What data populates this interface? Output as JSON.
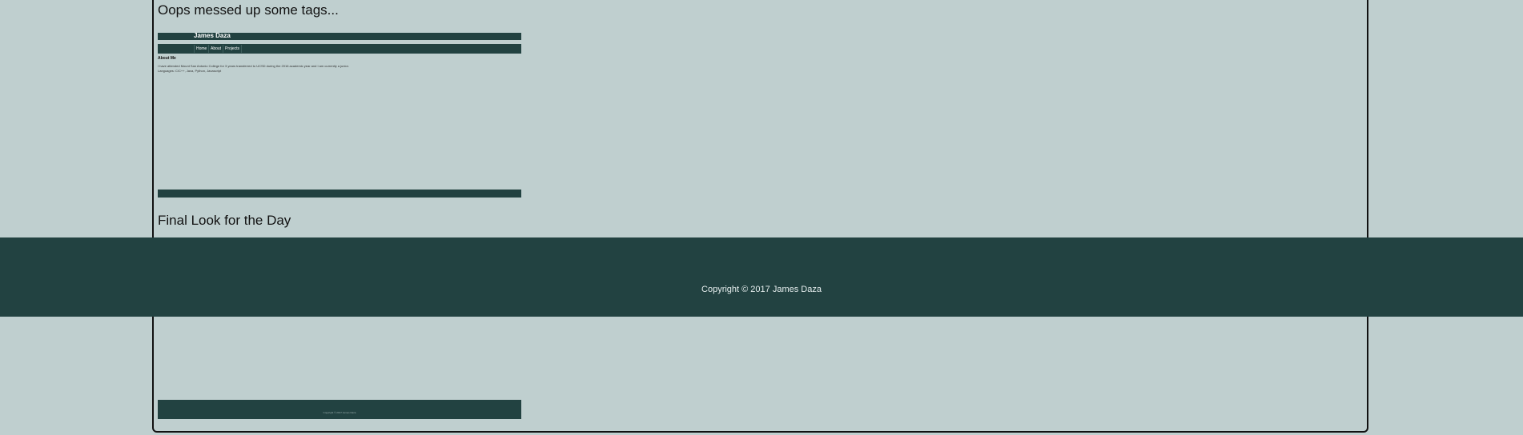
{
  "sections": {
    "oops_heading": "Oops messed up some tags...",
    "final_heading": "Final Look for the Day"
  },
  "screenshot1": {
    "site_title": "James Daza",
    "nav": [
      "Home",
      "About",
      "Projects"
    ],
    "about_title": "About Me",
    "about_text": "I have attended Mount San Antonio College for 3 years transferred to UCSD during the 2016 academic year and I am currently a junior.",
    "languages_text": "Languages: C/C++, Java, Python, Javascript"
  },
  "screenshot2": {
    "footer_copyright": "Copyright © 2017 James Daza"
  },
  "footer": {
    "copyright": "Copyright © 2017 James Daza"
  },
  "colors": {
    "background": "#bfcfcf",
    "dark_teal": "#224241"
  }
}
